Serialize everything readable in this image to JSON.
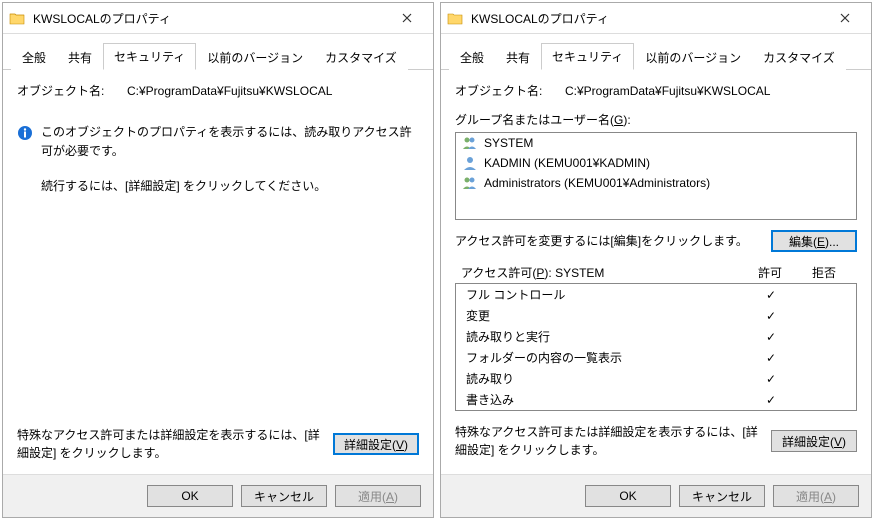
{
  "left": {
    "title": "KWSLOCALのプロパティ",
    "tabs": [
      "全般",
      "共有",
      "セキュリティ",
      "以前のバージョン",
      "カスタマイズ"
    ],
    "active_tab": 2,
    "object_label": "オブジェクト名:",
    "object_path": "C:¥ProgramData¥Fujitsu¥KWSLOCAL",
    "info_text": "このオブジェクトのプロパティを表示するには、読み取りアクセス許可が必要です。",
    "sub_text": "続行するには、[詳細設定] をクリックしてください。",
    "footer_note": "特殊なアクセス許可または詳細設定を表示するには、[詳細設定] をクリックします。",
    "advanced_label": "詳細設定(V)",
    "ok": "OK",
    "cancel": "キャンセル",
    "apply": "適用(A)"
  },
  "right": {
    "title": "KWSLOCALのプロパティ",
    "tabs": [
      "全般",
      "共有",
      "セキュリティ",
      "以前のバージョン",
      "カスタマイズ"
    ],
    "active_tab": 2,
    "object_label": "オブジェクト名:",
    "object_path": "C:¥ProgramData¥Fujitsu¥KWSLOCAL",
    "group_label": "グループ名またはユーザー名(G):",
    "users": [
      {
        "icon": "users",
        "name": "SYSTEM"
      },
      {
        "icon": "user",
        "name": "KADMIN (KEMU001¥KADMIN)"
      },
      {
        "icon": "users",
        "name": "Administrators (KEMU001¥Administrators)"
      }
    ],
    "edit_text": "アクセス許可を変更するには[編集]をクリックします。",
    "edit_label": "編集(E)...",
    "perm_header": "アクセス許可(P): SYSTEM",
    "col_allow": "許可",
    "col_deny": "拒否",
    "permissions": [
      {
        "name": "フル コントロール",
        "allow": true,
        "deny": false
      },
      {
        "name": "変更",
        "allow": true,
        "deny": false
      },
      {
        "name": "読み取りと実行",
        "allow": true,
        "deny": false
      },
      {
        "name": "フォルダーの内容の一覧表示",
        "allow": true,
        "deny": false
      },
      {
        "name": "読み取り",
        "allow": true,
        "deny": false
      },
      {
        "name": "書き込み",
        "allow": true,
        "deny": false
      }
    ],
    "footer_note": "特殊なアクセス許可または詳細設定を表示するには、[詳細設定] をクリックします。",
    "advanced_label": "詳細設定(V)",
    "ok": "OK",
    "cancel": "キャンセル",
    "apply": "適用(A)"
  }
}
